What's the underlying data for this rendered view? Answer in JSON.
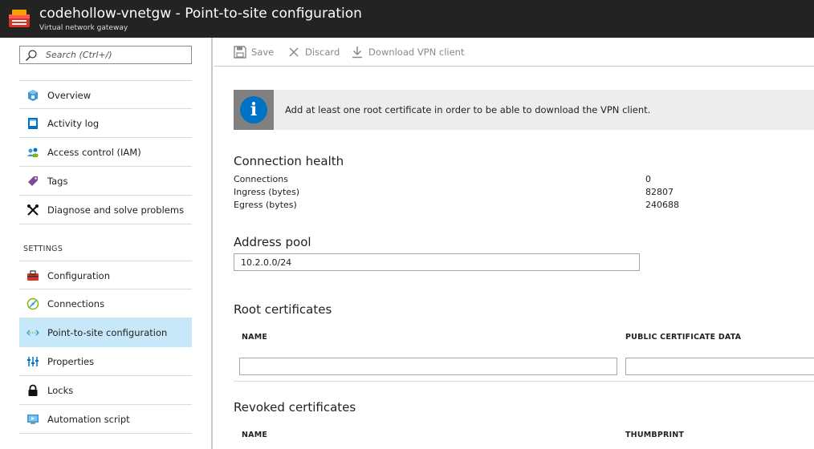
{
  "header": {
    "title": "codehollow-vnetgw - Point-to-site configuration",
    "subtitle": "Virtual network gateway",
    "logo_icon": "vpn-gateway-icon"
  },
  "sidebar": {
    "search_placeholder": "Search (Ctrl+/)",
    "items": [
      {
        "label": "Overview",
        "icon": "overview-icon"
      },
      {
        "label": "Activity log",
        "icon": "activity-log-icon"
      },
      {
        "label": "Access control (IAM)",
        "icon": "access-control-icon"
      },
      {
        "label": "Tags",
        "icon": "tag-icon"
      },
      {
        "label": "Diagnose and solve problems",
        "icon": "wrench-icon"
      }
    ],
    "settings_label": "SETTINGS",
    "settings_items": [
      {
        "label": "Configuration",
        "icon": "toolbox-icon"
      },
      {
        "label": "Connections",
        "icon": "connections-icon"
      },
      {
        "label": "Point-to-site configuration",
        "icon": "point-to-site-icon",
        "active": true
      },
      {
        "label": "Properties",
        "icon": "properties-icon"
      },
      {
        "label": "Locks",
        "icon": "lock-icon"
      },
      {
        "label": "Automation script",
        "icon": "automation-script-icon"
      }
    ],
    "active_color": "#c7e8f9"
  },
  "toolbar": {
    "save_label": "Save",
    "discard_label": "Discard",
    "download_label": "Download VPN client"
  },
  "info": {
    "message": "Add at least one root certificate in order to be able to download the VPN client."
  },
  "connection_health": {
    "title": "Connection health",
    "rows": [
      {
        "key": "Connections",
        "value": "0"
      },
      {
        "key": "Ingress (bytes)",
        "value": "82807"
      },
      {
        "key": "Egress (bytes)",
        "value": "240688"
      }
    ]
  },
  "address_pool": {
    "title": "Address pool",
    "value": "10.2.0.0/24"
  },
  "root_certificates": {
    "title": "Root certificates",
    "col_name": "NAME",
    "col_data": "PUBLIC CERTIFICATE DATA"
  },
  "revoked_certificates": {
    "title": "Revoked certificates",
    "col_name": "NAME",
    "col_thumbprint": "THUMBPRINT"
  },
  "colors": {
    "header_bg": "#232323",
    "info_blue": "#0072c6"
  }
}
